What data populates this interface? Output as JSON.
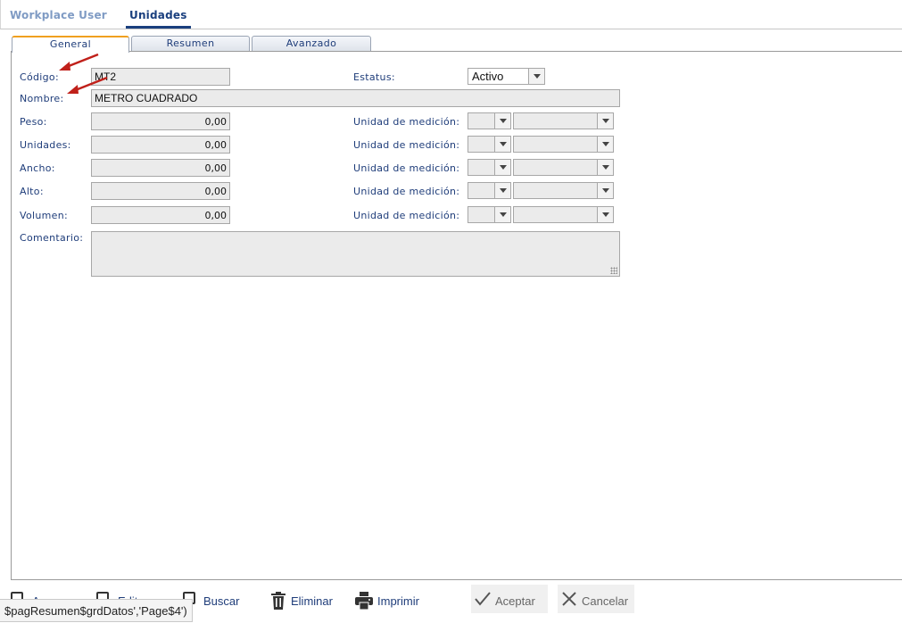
{
  "top_tabs": [
    "Workplace User",
    "Unidades"
  ],
  "sub_tabs": [
    "General",
    "Resumen",
    "Avanzado"
  ],
  "general": {
    "codigo_label": "Código:",
    "codigo_value": "MT2",
    "estatus_label": "Estatus:",
    "estatus_value": "Activo",
    "nombre_label": "Nombre:",
    "nombre_value": "METRO CUADRADO",
    "measures": [
      {
        "label": "Peso:",
        "value": "0,00",
        "unit_label": "Unidad de medición:"
      },
      {
        "label": "Unidades:",
        "value": "0,00",
        "unit_label": "Unidad de medición:"
      },
      {
        "label": "Ancho:",
        "value": "0,00",
        "unit_label": "Unidad de medición:"
      },
      {
        "label": "Alto:",
        "value": "0,00",
        "unit_label": "Unidad de medición:"
      },
      {
        "label": "Volumen:",
        "value": "0,00",
        "unit_label": "Unidad de medición:"
      }
    ],
    "comentario_label": "Comentario:"
  },
  "toolbar": {
    "partial1": "A",
    "partial2": "Edit",
    "buscar": "Buscar",
    "eliminar": "Eliminar",
    "imprimir": "Imprimir",
    "aceptar": "Aceptar",
    "cancelar": "Cancelar"
  },
  "status_tip": "$pagResumen$grdDatos','Page$4')",
  "colors": {
    "accent": "#1a3f7e",
    "label": "#1f3d7a",
    "tab_highlight": "#f0a020",
    "annotation_arrow": "#c0201a"
  }
}
